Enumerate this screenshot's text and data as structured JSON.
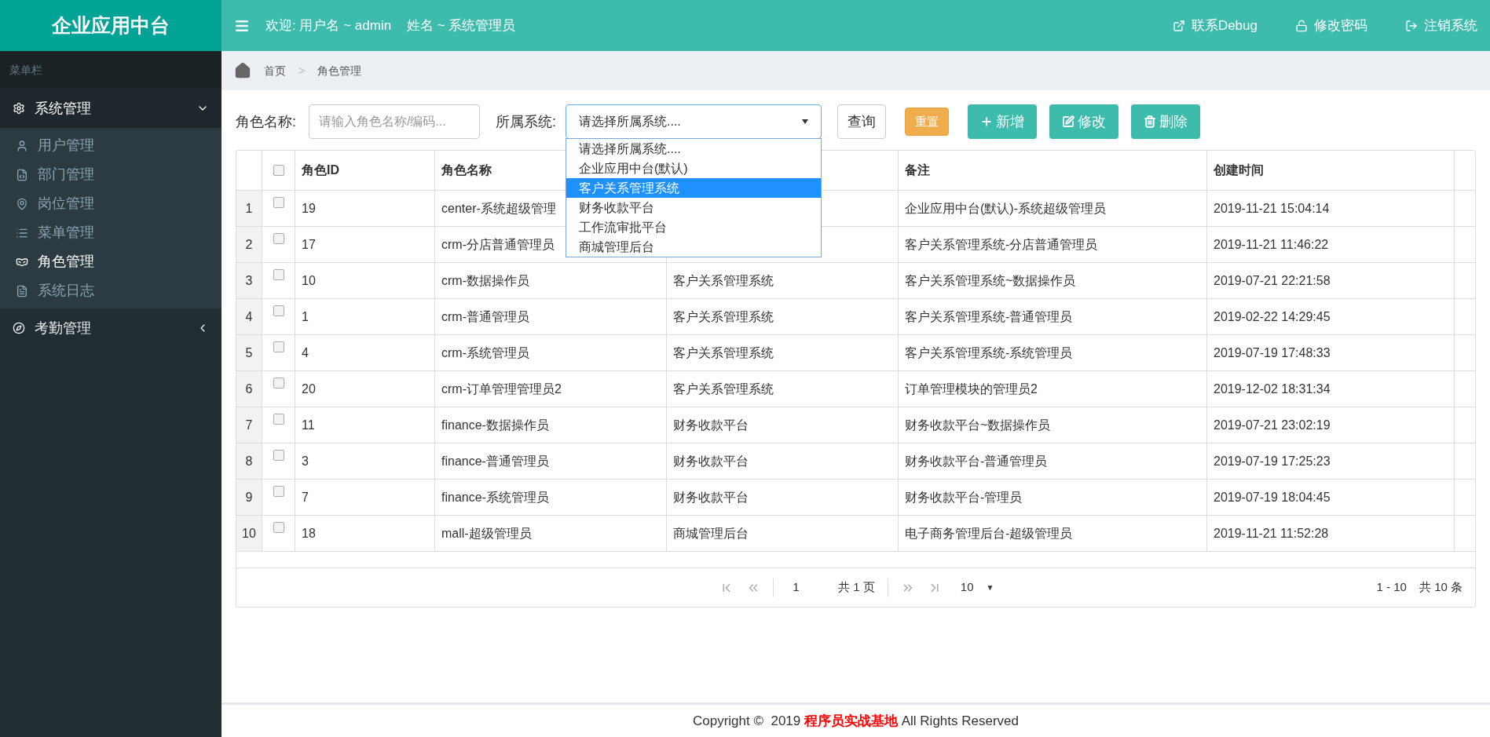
{
  "header": {
    "logo": "企业应用中台",
    "welcome_user": "欢迎: 用户名 ~ admin",
    "welcome_name": "姓名 ~ 系统管理员",
    "actions": [
      "联系Debug",
      "修改密码",
      "注销系统"
    ]
  },
  "sidebar": {
    "caption": "菜单栏",
    "groups": [
      {
        "label": "系统管理",
        "expanded": true,
        "children": [
          {
            "label": "用户管理",
            "selected": false
          },
          {
            "label": "部门管理",
            "selected": false
          },
          {
            "label": "岗位管理",
            "selected": false
          },
          {
            "label": "菜单管理",
            "selected": false
          },
          {
            "label": "角色管理",
            "selected": true
          },
          {
            "label": "系统日志",
            "selected": false
          }
        ]
      },
      {
        "label": "考勤管理",
        "expanded": false
      }
    ]
  },
  "breadcrumb": [
    "首页",
    "角色管理"
  ],
  "breadcrumb_separator": ">",
  "filters": {
    "name_label": "角色名称:",
    "name_placeholder": "请输入角色名称/编码...",
    "system_label": "所属系统:",
    "system_value": "请选择所属系统....",
    "options": [
      {
        "label": "请选择所属系统....",
        "selected": false
      },
      {
        "label": "企业应用中台(默认)",
        "selected": false
      },
      {
        "label": "客户关系管理系统",
        "selected": true
      },
      {
        "label": "财务收款平台",
        "selected": false
      },
      {
        "label": "工作流审批平台",
        "selected": false
      },
      {
        "label": "商城管理后台",
        "selected": false
      }
    ]
  },
  "buttons": [
    {
      "label": "查询",
      "kind": "plain"
    },
    {
      "label": "重置",
      "kind": "warning"
    },
    {
      "label": "新增",
      "kind": "add"
    },
    {
      "label": "修改",
      "kind": "edit"
    },
    {
      "label": "删除",
      "kind": "delete"
    }
  ],
  "table": {
    "header_checked": false,
    "columns": [
      "角色ID",
      "角色名称",
      null,
      "备注",
      "创建时间"
    ],
    "rows": [
      {
        "no": "1",
        "checked": false,
        "cells": [
          "19",
          "center-系统超级管理",
          null,
          "企业应用中台(默认)-系统超级管理员",
          "2019-11-21 15:04:14"
        ]
      },
      {
        "no": "2",
        "checked": false,
        "cells": [
          "17",
          "crm-分店普通管理员",
          null,
          "客户关系管理系统-分店普通管理员",
          "2019-11-21 11:46:22"
        ]
      },
      {
        "no": "3",
        "checked": false,
        "cells": [
          "10",
          "crm-数据操作员",
          "客户关系管理系统",
          "客户关系管理系统~数据操作员",
          "2019-07-21 22:21:58"
        ]
      },
      {
        "no": "4",
        "checked": false,
        "cells": [
          "1",
          "crm-普通管理员",
          "客户关系管理系统",
          "客户关系管理系统-普通管理员",
          "2019-02-22 14:29:45"
        ]
      },
      {
        "no": "5",
        "checked": false,
        "cells": [
          "4",
          "crm-系统管理员",
          "客户关系管理系统",
          "客户关系管理系统-系统管理员",
          "2019-07-19 17:48:33"
        ]
      },
      {
        "no": "6",
        "checked": false,
        "cells": [
          "20",
          "crm-订单管理管理员2",
          "客户关系管理系统",
          "订单管理模块的管理员2",
          "2019-12-02 18:31:34"
        ]
      },
      {
        "no": "7",
        "checked": false,
        "cells": [
          "11",
          "finance-数据操作员",
          "财务收款平台",
          "财务收款平台~数据操作员",
          "2019-07-21 23:02:19"
        ]
      },
      {
        "no": "8",
        "checked": false,
        "cells": [
          "3",
          "finance-普通管理员",
          "财务收款平台",
          "财务收款平台-普通管理员",
          "2019-07-19 17:25:23"
        ]
      },
      {
        "no": "9",
        "checked": false,
        "cells": [
          "7",
          "finance-系统管理员",
          "财务收款平台",
          "财务收款平台-管理员",
          "2019-07-19 18:04:45"
        ]
      },
      {
        "no": "10",
        "checked": false,
        "cells": [
          "18",
          "mall-超级管理员",
          "商城管理后台",
          "电子商务管理后台-超级管理员",
          "2019-11-21 11:52:28"
        ]
      }
    ]
  },
  "pager": {
    "page": "1",
    "total_pages": "共 1 页",
    "page_size": "10",
    "page_size_arrow": "▼",
    "range": "1 - 10",
    "total": "共 10 条"
  },
  "footer": "Copyright ©  2019 **程序员实战基地** All Rights Reserved"
}
